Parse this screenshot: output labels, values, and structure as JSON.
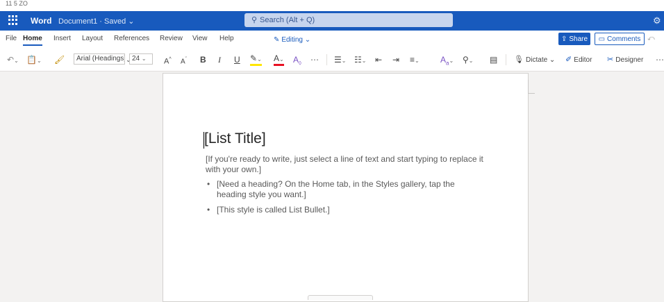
{
  "top_strip": {
    "text": "11 5 ZO"
  },
  "titlebar": {
    "app_name": "Word",
    "doc_title": "Document1 · Saved ⌄",
    "search_placeholder": "Search (Alt + Q)"
  },
  "tabs": [
    {
      "label": "File"
    },
    {
      "label": "Home"
    },
    {
      "label": "Insert"
    },
    {
      "label": "Layout"
    },
    {
      "label": "References"
    },
    {
      "label": "Review"
    },
    {
      "label": "View"
    },
    {
      "label": "Help"
    }
  ],
  "editing_label": "Editing ⌄",
  "share_label": "Share",
  "comments_label": "Comments",
  "toolbar": {
    "font_name": "Arial (Headings)",
    "font_size": "24",
    "dictate_label": "Dictate ⌄",
    "editor_label": "Editor",
    "designer_label": "Designer"
  },
  "document": {
    "title": "[List Title]",
    "intro": "[If you're ready to write, just select a line of text and start typing to replace it with your own.]",
    "bullets": [
      "[Need a heading? On the Home tab, in the Styles gallery, tap the heading style you want.]",
      "[This style is called List Bullet.]"
    ]
  }
}
